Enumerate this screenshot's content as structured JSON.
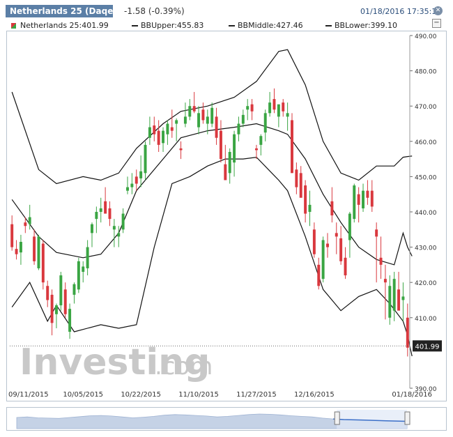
{
  "header": {
    "tab_title": "Netherlands 25 (Daqe...",
    "change": "-1.58 (-0.39%)",
    "datetime": "01/18/2016 17:35:11",
    "close_symbol": "✕"
  },
  "toolbar": {
    "instrument": "Netherlands 25:401.99",
    "bb_upper": "BBUpper:455.83",
    "bb_middle": "BBMiddle:427.46",
    "bb_lower": "BBLower:399.10",
    "minimize_symbol": "−"
  },
  "watermark": {
    "brand": "Investing",
    "suffix": ".com"
  },
  "colors": {
    "up": "#3aa543",
    "down": "#d9383e",
    "line": "#111111",
    "price_tag": "#222222",
    "nav_fill": "#c5d2e6",
    "nav_selected": "#3b6fc8"
  },
  "chart_data": {
    "type": "candlestick",
    "ylim": [
      390,
      490
    ],
    "yticks": [
      490,
      480,
      470,
      460,
      450,
      440,
      430,
      420,
      410,
      390
    ],
    "y_tick_labels": [
      "490.00",
      "480.00",
      "470.00",
      "460.00",
      "450.00",
      "440.00",
      "430.00",
      "420.00",
      "410.00",
      "390.00"
    ],
    "x_tick_labels": [
      "09/11/2015",
      "10/05/2015",
      "10/22/2015",
      "11/10/2015",
      "11/27/2015",
      "12/16/2015",
      "01/18/2016"
    ],
    "x_tick_index": [
      0,
      16,
      29,
      42,
      55,
      68,
      90
    ],
    "last_price": 401.99,
    "last_price_label": "401.99",
    "candles": [
      [
        436.5,
        439.0,
        429.0,
        430.0
      ],
      [
        429.5,
        432.0,
        426.5,
        428.0
      ],
      [
        428.5,
        433.5,
        425.0,
        431.5
      ],
      [
        437.0,
        438.5,
        434.0,
        436.0
      ],
      [
        436.5,
        442.0,
        435.0,
        438.5
      ],
      [
        433.0,
        435.0,
        425.0,
        426.0
      ],
      [
        424.0,
        433.5,
        423.5,
        433.0
      ],
      [
        431.0,
        432.0,
        418.0,
        420.0
      ],
      [
        419.0,
        420.5,
        413.0,
        415.0
      ],
      [
        416.5,
        418.0,
        405.0,
        408.5
      ],
      [
        411.0,
        414.0,
        407.0,
        413.5
      ],
      [
        413.5,
        423.0,
        412.0,
        422.0
      ],
      [
        418.0,
        420.0,
        410.0,
        411.0
      ],
      [
        406.0,
        414.0,
        404.0,
        412.5
      ],
      [
        416.5,
        420.0,
        414.0,
        419.5
      ],
      [
        418.0,
        427.0,
        417.0,
        426.0
      ],
      [
        423.0,
        426.0,
        420.0,
        424.5
      ],
      [
        424.0,
        432.0,
        422.0,
        430.0
      ],
      [
        434.0,
        437.0,
        430.0,
        436.5
      ],
      [
        438.0,
        441.5,
        434.0,
        440.0
      ],
      [
        440.0,
        444.0,
        437.0,
        441.0
      ],
      [
        443.0,
        447.0,
        440.0,
        439.5
      ],
      [
        441.0,
        443.0,
        436.0,
        438.0
      ],
      [
        435.0,
        438.0,
        430.0,
        436.0
      ],
      [
        433.0,
        436.0,
        430.0,
        434.0
      ],
      [
        435.0,
        441.0,
        434.0,
        439.5
      ],
      [
        446.0,
        450.0,
        445.0,
        447.0
      ],
      [
        447.0,
        451.0,
        445.0,
        448.0
      ],
      [
        450.0,
        452.0,
        446.0,
        448.0
      ],
      [
        449.5,
        456.0,
        447.0,
        451.5
      ],
      [
        451.0,
        460.0,
        449.0,
        459.0
      ],
      [
        461.0,
        467.0,
        459.0,
        464.0
      ],
      [
        464.5,
        467.0,
        460.0,
        462.0
      ],
      [
        463.0,
        466.0,
        457.0,
        459.0
      ],
      [
        459.5,
        464.0,
        457.0,
        463.0
      ],
      [
        462.0,
        466.0,
        459.0,
        465.0
      ],
      [
        464.0,
        469.0,
        461.0,
        463.0
      ],
      [
        465.0,
        466.5,
        460.0,
        466.0
      ],
      [
        458.0,
        460.0,
        455.0,
        457.5
      ],
      [
        465.0,
        471.0,
        464.0,
        467.0
      ],
      [
        467.0,
        472.0,
        466.0,
        470.0
      ],
      [
        470.0,
        474.0,
        468.0,
        468.5
      ],
      [
        464.0,
        470.0,
        462.0,
        468.0
      ],
      [
        469.0,
        471.0,
        465.0,
        466.0
      ],
      [
        465.0,
        469.0,
        462.0,
        467.0
      ],
      [
        465.0,
        471.0,
        464.0,
        469.5
      ],
      [
        467.0,
        469.5,
        459.0,
        461.0
      ],
      [
        463.0,
        466.0,
        454.0,
        455.0
      ],
      [
        453.5,
        459.0,
        452.0,
        449.0
      ],
      [
        451.0,
        458.0,
        448.0,
        457.0
      ],
      [
        454.0,
        463.0,
        450.0,
        462.0
      ],
      [
        462.0,
        467.0,
        460.0,
        465.0
      ],
      [
        465.0,
        469.0,
        464.0,
        467.5
      ],
      [
        469.0,
        472.0,
        466.0,
        470.0
      ],
      [
        470.5,
        472.0,
        466.0,
        468.5
      ],
      [
        458.0,
        459.0,
        455.0,
        457.5
      ],
      [
        459.0,
        462.0,
        456.0,
        461.5
      ],
      [
        462.5,
        469.0,
        460.0,
        468.0
      ],
      [
        468.0,
        474.0,
        467.0,
        471.0
      ],
      [
        472.0,
        475.0,
        468.0,
        469.0
      ],
      [
        467.0,
        470.0,
        464.0,
        470.5
      ],
      [
        471.0,
        472.0,
        467.0,
        468.5
      ],
      [
        467.0,
        471.0,
        463.0,
        468.0
      ],
      [
        466.0,
        468.0,
        455.0,
        451.0
      ],
      [
        452.0,
        454.0,
        445.0,
        447.0
      ],
      [
        451.0,
        453.0,
        446.0,
        444.0
      ],
      [
        447.5,
        449.0,
        437.0,
        439.5
      ],
      [
        440.0,
        446.0,
        436.0,
        442.0
      ],
      [
        435.0,
        437.0,
        427.0,
        428.0
      ],
      [
        425.0,
        427.0,
        418.0,
        419.0
      ],
      [
        421.0,
        433.0,
        420.0,
        432.0
      ],
      [
        431.0,
        434.0,
        427.0,
        430.0
      ],
      [
        443.0,
        447.0,
        437.0,
        439.0
      ],
      [
        434.0,
        437.0,
        428.0,
        433.0
      ],
      [
        432.5,
        436.0,
        425.0,
        426.0
      ],
      [
        427.0,
        430.0,
        421.0,
        422.0
      ],
      [
        432.0,
        440.0,
        427.0,
        439.5
      ],
      [
        438.0,
        448.0,
        437.0,
        447.5
      ],
      [
        445.0,
        447.0,
        437.0,
        442.0
      ],
      [
        441.0,
        448.0,
        440.0,
        446.0
      ],
      [
        446.0,
        449.0,
        442.0,
        444.0
      ],
      [
        446.0,
        449.0,
        440.0,
        441.5
      ],
      [
        435.0,
        437.0,
        420.0,
        433.0
      ],
      [
        427.0,
        433.0,
        421.0,
        425.0
      ],
      [
        421.0,
        425.0,
        409.5,
        420.0
      ],
      [
        410.0,
        422.0,
        408.0,
        419.0
      ],
      [
        412.0,
        423.0,
        409.0,
        421.0
      ],
      [
        418.0,
        423.0,
        413.0,
        412.0
      ],
      [
        415.0,
        420.0,
        409.0,
        416.0
      ],
      [
        410.0,
        414.0,
        399.0,
        401.5
      ]
    ],
    "bb_upper": [
      [
        0,
        474.0
      ],
      [
        6,
        452.0
      ],
      [
        10,
        448.0
      ],
      [
        16,
        450.0
      ],
      [
        20,
        449.0
      ],
      [
        24,
        451.0
      ],
      [
        28,
        458.0
      ],
      [
        34,
        465.0
      ],
      [
        38,
        468.5
      ],
      [
        44,
        470.0
      ],
      [
        50,
        472.5
      ],
      [
        55,
        477.0
      ],
      [
        60,
        485.5
      ],
      [
        62,
        486.0
      ],
      [
        66,
        476.0
      ],
      [
        70,
        460.0
      ],
      [
        74,
        451.0
      ],
      [
        78,
        449.0
      ],
      [
        82,
        453.0
      ],
      [
        86,
        453.0
      ],
      [
        88,
        455.5
      ],
      [
        89,
        455.7
      ],
      [
        90,
        455.83
      ]
    ],
    "bb_middle": [
      [
        0,
        443.5
      ],
      [
        6,
        433.0
      ],
      [
        10,
        428.5
      ],
      [
        16,
        427.0
      ],
      [
        20,
        428.0
      ],
      [
        24,
        434.0
      ],
      [
        28,
        446.0
      ],
      [
        34,
        455.0
      ],
      [
        38,
        461.0
      ],
      [
        44,
        463.0
      ],
      [
        50,
        464.0
      ],
      [
        55,
        465.0
      ],
      [
        60,
        463.0
      ],
      [
        62,
        462.0
      ],
      [
        66,
        455.0
      ],
      [
        70,
        445.0
      ],
      [
        74,
        437.0
      ],
      [
        78,
        430.0
      ],
      [
        82,
        426.5
      ],
      [
        86,
        425.0
      ],
      [
        88,
        434.0
      ],
      [
        89,
        430.0
      ],
      [
        90,
        427.46
      ]
    ],
    "bb_lower": [
      [
        0,
        413.0
      ],
      [
        4,
        420.0
      ],
      [
        8,
        409.0
      ],
      [
        10,
        413.5
      ],
      [
        14,
        406.0
      ],
      [
        20,
        408.0
      ],
      [
        24,
        407.0
      ],
      [
        28,
        408.0
      ],
      [
        32,
        430.0
      ],
      [
        36,
        448.0
      ],
      [
        40,
        450.0
      ],
      [
        44,
        453.0
      ],
      [
        48,
        455.0
      ],
      [
        52,
        455.0
      ],
      [
        55,
        455.5
      ],
      [
        60,
        449.0
      ],
      [
        62,
        446.0
      ],
      [
        66,
        433.0
      ],
      [
        70,
        418.0
      ],
      [
        74,
        412.0
      ],
      [
        78,
        416.0
      ],
      [
        82,
        418.0
      ],
      [
        85,
        414.0
      ],
      [
        88,
        409.0
      ],
      [
        89,
        405.0
      ],
      [
        90,
        399.1
      ]
    ],
    "navigator": {
      "values": [
        38,
        40,
        37,
        36,
        35,
        38,
        41,
        44,
        45,
        43,
        40,
        37,
        39,
        42,
        46,
        48,
        47,
        45,
        43,
        40,
        42,
        45,
        48,
        50,
        49,
        47,
        44,
        42,
        40,
        36,
        33,
        31,
        30,
        29,
        28,
        27,
        26,
        25
      ],
      "selected_start": 0.82
    }
  }
}
